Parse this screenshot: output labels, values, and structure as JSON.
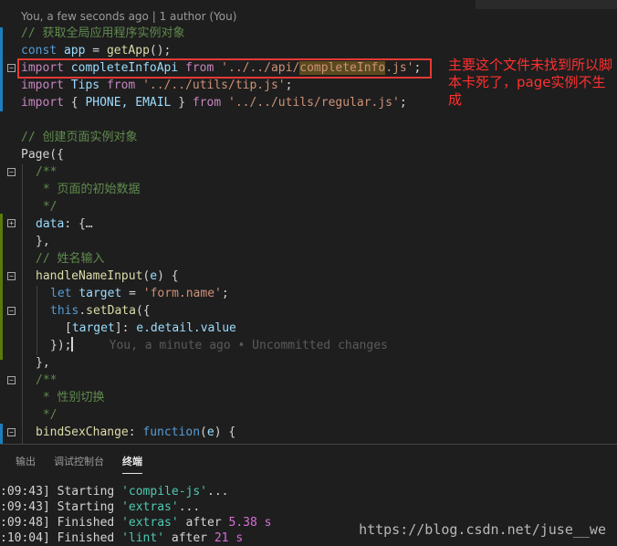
{
  "editor": {
    "blame_header": "You, a few seconds ago | 1 author (You)",
    "inline_blame": "You, a minute ago • Uncommitted changes",
    "lines": {
      "l1": "// 获取全局应用程序实例对象",
      "l2_kw": "const",
      "l2_var": "app",
      "l2_fn": "getApp",
      "l3_kw": "import",
      "l3_name": "completeInfoApi",
      "l3_from": "from",
      "l3_str_a": "'../../api/",
      "l3_str_hl": "completeInfo",
      "l3_str_b": ".js'",
      "l4_kw": "import",
      "l4_name": "Tips",
      "l4_from": "from",
      "l4_str": "'../../utils/tip.js'",
      "l5_kw": "import",
      "l5_names": "PHONE, EMAIL",
      "l5_from": "from",
      "l5_str": "'../../utils/regular.js'",
      "l7": "// 创建页面实例对象",
      "l8": "Page({",
      "l9": "/**",
      "l10": " * 页面的初始数据",
      "l11": " */",
      "l12_key": "data",
      "l12_rest": ": {…",
      "l13": "},",
      "l14": "// 姓名输入",
      "l15_fn": "handleNameInput",
      "l15_param": "e",
      "l16_kw": "let",
      "l16_var": "target",
      "l16_str": "'form.name'",
      "l17_this": "this",
      "l17_fn": "setData",
      "l18_var": "target",
      "l18_rest": "e.detail.value",
      "l19": "});",
      "l20": "},",
      "l21": "/**",
      "l22": " * 性别切换",
      "l23": " */",
      "l24_fn": "bindSexChange",
      "l24_kw": "function",
      "l24_param": "e"
    }
  },
  "annotation": {
    "text": "主要这个文件未找到所以脚本卡死了，page实例不生成"
  },
  "panel": {
    "tabs": [
      "输出",
      "调试控制台",
      "终端"
    ],
    "terminal": [
      {
        "time": ":09:43]",
        "verb": "Starting",
        "task": "'compile-js'",
        "tail": "..."
      },
      {
        "time": ":09:43]",
        "verb": "Starting",
        "task": "'extras'",
        "tail": "..."
      },
      {
        "time": ":09:48]",
        "verb": "Finished",
        "task": "'extras'",
        "tail": "after",
        "dur": "5.38 s"
      },
      {
        "time": ":10:04]",
        "verb": "Finished",
        "task": "'lint'",
        "tail": "after",
        "dur": "21 s"
      }
    ]
  },
  "watermark": "https://blog.csdn.net/juse__we",
  "colors": {
    "annotation": "#ff3030",
    "box": "#e53935",
    "keyword": "#569cd6",
    "string": "#ce9178",
    "comment": "#608b4e"
  }
}
